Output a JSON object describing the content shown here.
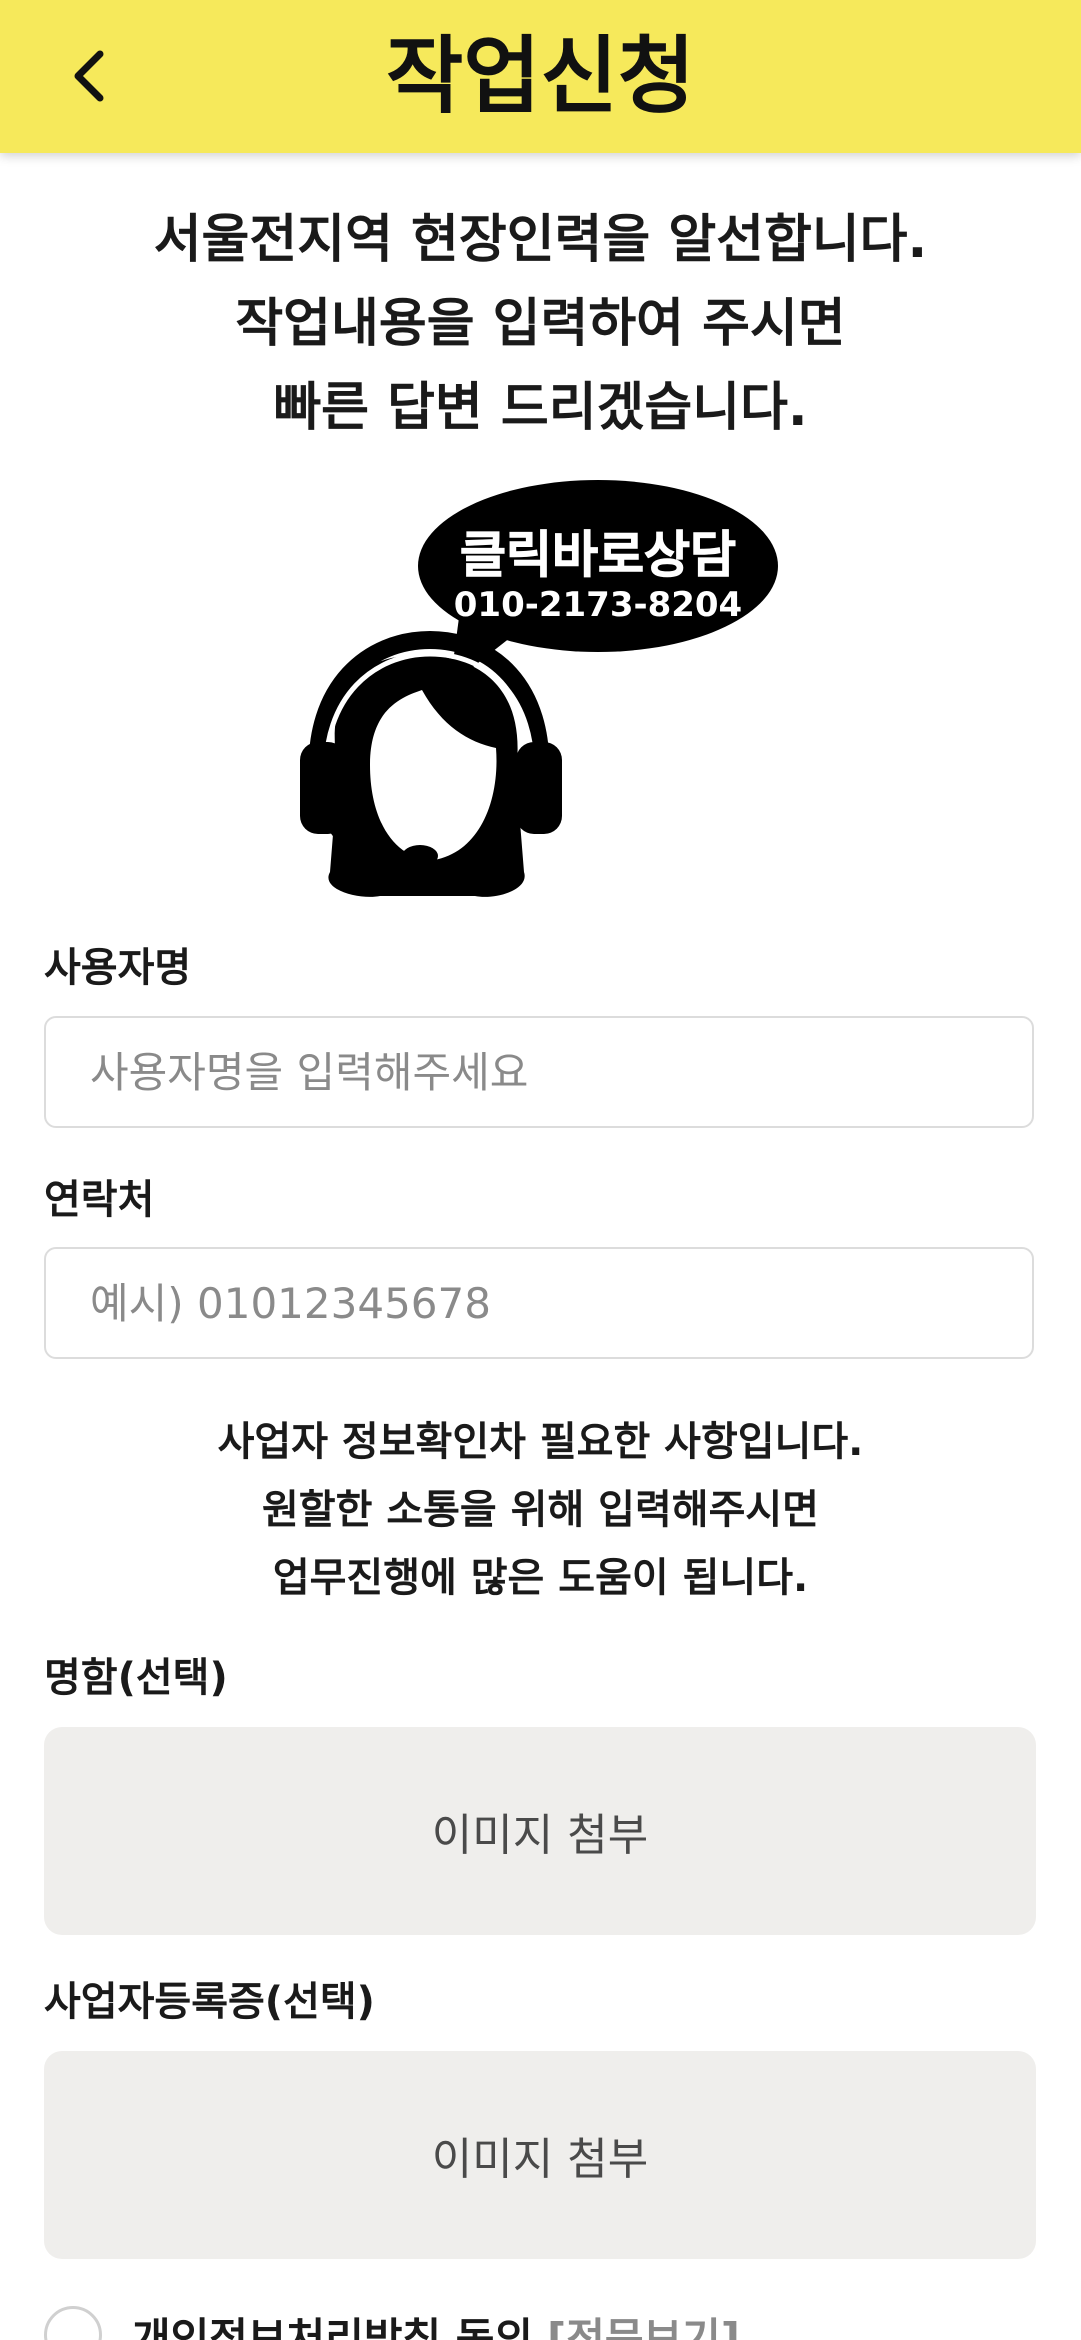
{
  "header": {
    "title": "작업신청",
    "back_icon": "chevron-left-icon",
    "background": "#f6e95b"
  },
  "intro": {
    "lines": [
      "서울전지역 현장인력을 알선합니다.",
      "작업내용을 입력하여 주시면",
      "빠른 답변 드리겠습니다."
    ]
  },
  "consult_image": {
    "bubble_title": "클릭바로상담",
    "bubble_phone": "010-2173-8204",
    "icon": "headset-agent-icon"
  },
  "form": {
    "username": {
      "label": "사용자명",
      "placeholder": "사용자명을 입력해주세요",
      "value": ""
    },
    "contact": {
      "label": "연락처",
      "placeholder": "예시) 01012345678",
      "value": ""
    },
    "notice": {
      "lines": [
        "사업자 정보확인차 필요한 사항입니다.",
        "원할한 소통을 위해 입력해주시면",
        "업무진행에 많은 도움이 됩니다."
      ]
    },
    "business_card": {
      "label": "명함(선택)",
      "attach_label": "이미지 첨부"
    },
    "business_registration": {
      "label": "사업자등록증(선택)",
      "attach_label": "이미지 첨부"
    },
    "privacy": {
      "label": "개인정보처리방침 동의",
      "link_label": "[전문보기]",
      "checked": false
    }
  }
}
